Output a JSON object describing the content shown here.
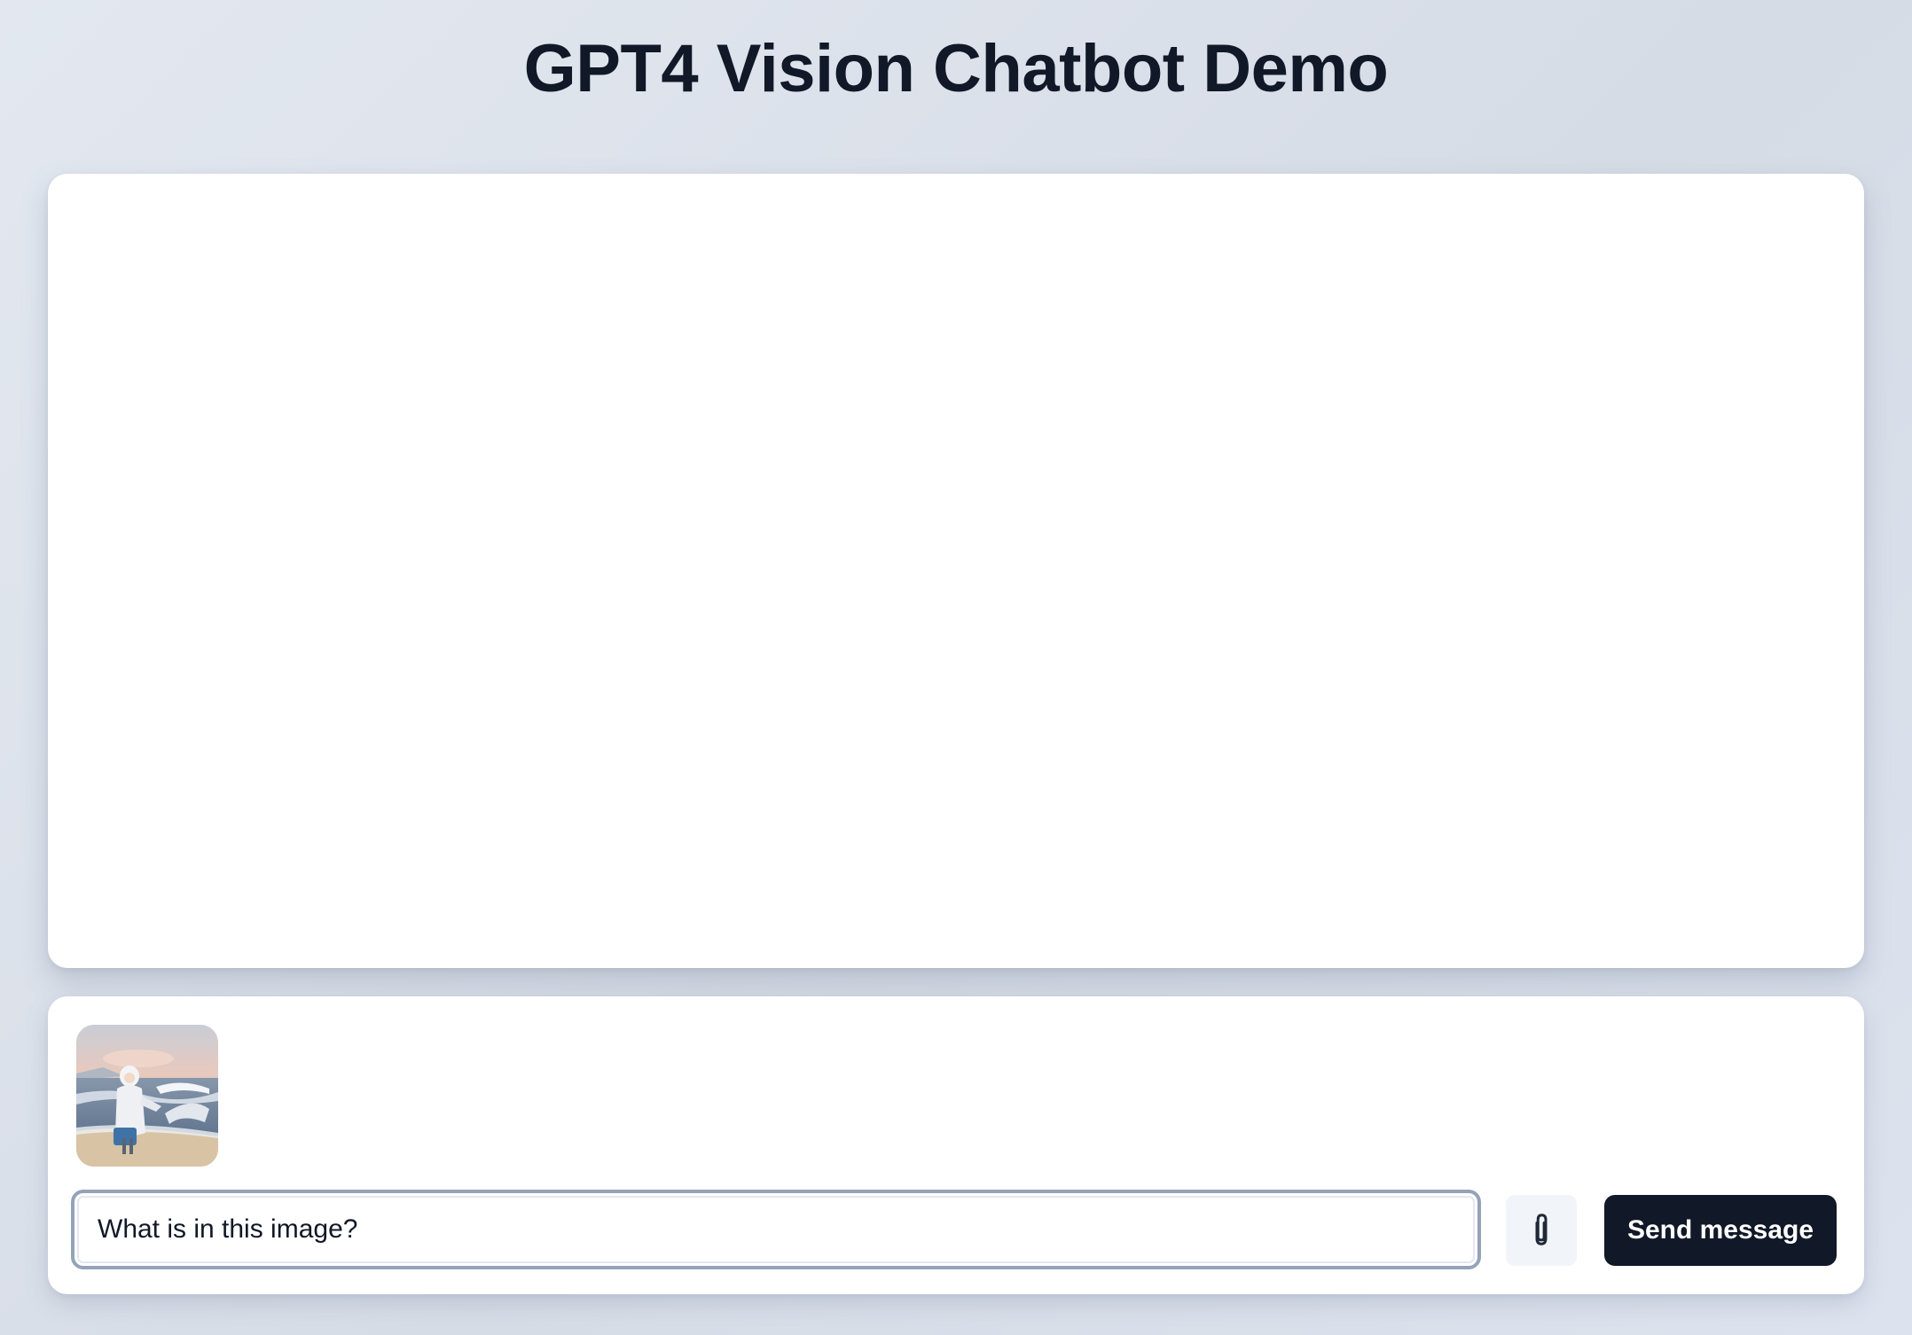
{
  "header": {
    "title": "GPT4 Vision Chatbot Demo"
  },
  "chat": {
    "messages": []
  },
  "composer": {
    "attachment": {
      "icon": "attached-image-thumbnail"
    },
    "input_value": "What is in this image?",
    "attach_icon": "paperclip-icon",
    "send_label": "Send message"
  },
  "colors": {
    "title_text": "#111827",
    "send_button_bg": "#111827",
    "attach_button_bg": "#f1f5f9",
    "input_border": "#94a3b8"
  }
}
